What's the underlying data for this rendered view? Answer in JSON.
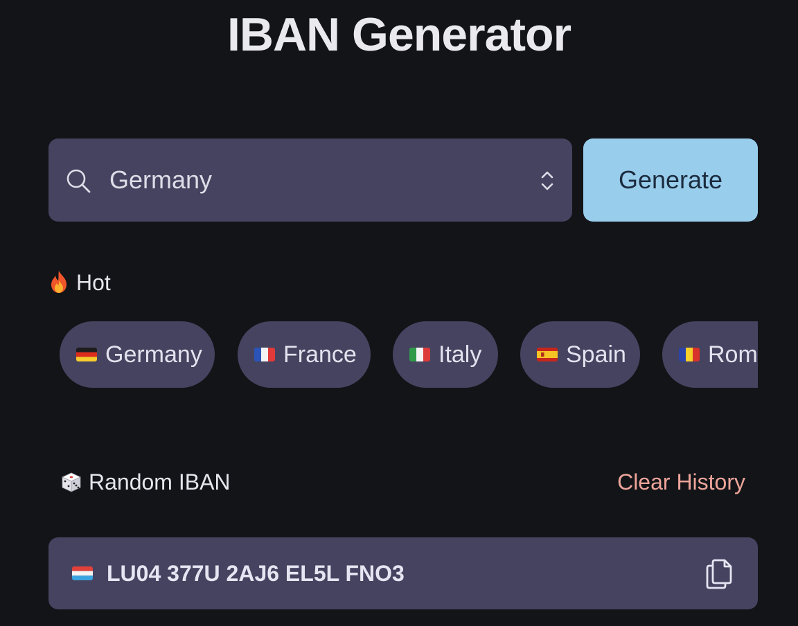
{
  "header": {
    "title": "IBAN Generator"
  },
  "search": {
    "value": "Germany",
    "icon": "search-icon",
    "dropdown_icon": "chevron-up-down-icon"
  },
  "generate": {
    "label": "Generate"
  },
  "hot": {
    "label": "Hot",
    "icon": "fire-icon",
    "countries": [
      {
        "label": "Germany",
        "flag": "flag-de"
      },
      {
        "label": "France",
        "flag": "flag-fr"
      },
      {
        "label": "Italy",
        "flag": "flag-it"
      },
      {
        "label": "Spain",
        "flag": "flag-es"
      },
      {
        "label": "Roma",
        "flag": "flag-ro"
      }
    ]
  },
  "random": {
    "label": "Random IBAN",
    "icon": "dice-icon",
    "clear_label": "Clear History"
  },
  "history": [
    {
      "iban": "LU04 377U 2AJ6 EL5L FNO3",
      "flag": "flag-lu"
    }
  ],
  "colors": {
    "background": "#121418",
    "panel": "#464360",
    "accent": "#99cdec",
    "clear_history": "#eea59a"
  }
}
